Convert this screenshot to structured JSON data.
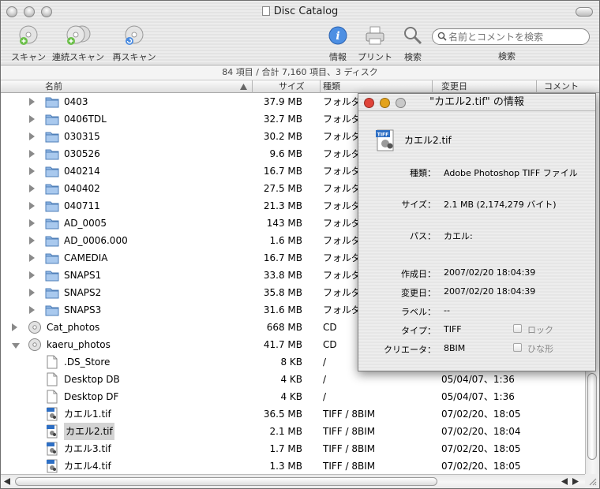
{
  "window": {
    "title": "Disc Catalog"
  },
  "toolbar": {
    "scan": "スキャン",
    "batch_scan": "連続スキャン",
    "rescan": "再スキャン",
    "info": "情報",
    "print": "プリント",
    "search": "検索",
    "search_placeholder": "名前とコメントを検索",
    "search_label": "検索"
  },
  "status": "84 項目 / 合計 7,160 項目、3 ディスク",
  "columns": {
    "name": "名前",
    "size": "サイズ",
    "kind": "種類",
    "modified": "変更日",
    "comment": "コメント"
  },
  "rows": [
    {
      "name": "0403",
      "size": "37.9 MB",
      "kind": "フォルダ",
      "date": ""
    },
    {
      "name": "0406TDL",
      "size": "32.7 MB",
      "kind": "フォルダ",
      "date": ""
    },
    {
      "name": "030315",
      "size": "30.2 MB",
      "kind": "フォルダ",
      "date": ""
    },
    {
      "name": "030526",
      "size": "9.6 MB",
      "kind": "フォルダ",
      "date": ""
    },
    {
      "name": "040214",
      "size": "16.7 MB",
      "kind": "フォルダ",
      "date": ""
    },
    {
      "name": "040402",
      "size": "27.5 MB",
      "kind": "フォルダ",
      "date": ""
    },
    {
      "name": "040711",
      "size": "21.3 MB",
      "kind": "フォルダ",
      "date": ""
    },
    {
      "name": "AD_0005",
      "size": "143 MB",
      "kind": "フォルダ",
      "date": ""
    },
    {
      "name": "AD_0006.000",
      "size": "1.6 MB",
      "kind": "フォルダ",
      "date": ""
    },
    {
      "name": "CAMEDIA",
      "size": "16.7 MB",
      "kind": "フォルダ",
      "date": ""
    },
    {
      "name": "SNAPS1",
      "size": "33.8 MB",
      "kind": "フォルダ",
      "date": ""
    },
    {
      "name": "SNAPS2",
      "size": "35.8 MB",
      "kind": "フォルダ",
      "date": ""
    },
    {
      "name": "SNAPS3",
      "size": "31.6 MB",
      "kind": "フォルダ",
      "date": ""
    },
    {
      "name": "Cat_photos",
      "size": "668 MB",
      "kind": "CD",
      "date": ""
    },
    {
      "name": "kaeru_photos",
      "size": "41.7 MB",
      "kind": "CD",
      "date": ""
    },
    {
      "name": ".DS_Store",
      "size": "8 KB",
      "kind": "/",
      "date": ""
    },
    {
      "name": "Desktop DB",
      "size": "4 KB",
      "kind": "/",
      "date": "05/04/07、1:36"
    },
    {
      "name": "Desktop DF",
      "size": "4 KB",
      "kind": "/",
      "date": "05/04/07、1:36"
    },
    {
      "name": "カエル1.tif",
      "size": "36.5 MB",
      "kind": "TIFF / 8BIM",
      "date": "07/02/20、18:05"
    },
    {
      "name": "カエル2.tif",
      "size": "2.1 MB",
      "kind": "TIFF / 8BIM",
      "date": "07/02/20、18:04"
    },
    {
      "name": "カエル3.tif",
      "size": "1.7 MB",
      "kind": "TIFF / 8BIM",
      "date": "07/02/20、18:05"
    },
    {
      "name": "カエル4.tif",
      "size": "1.3 MB",
      "kind": "TIFF / 8BIM",
      "date": "07/02/20、18:05"
    }
  ],
  "info_window": {
    "title": "\"カエル2.tif\" の情報",
    "icon_badge": "TIFF",
    "filename": "カエル2.tif",
    "labels": {
      "kind": "種類：",
      "size": "サイズ：",
      "path": "パス：",
      "created": "作成日：",
      "modified": "変更日：",
      "label": "ラベル：",
      "type": "タイプ：",
      "creator": "クリエータ："
    },
    "kind": "Adobe Photoshop TIFF ファイル",
    "size": "2.1 MB (2,174,279 バイト)",
    "path": "カエル:",
    "created": "2007/02/20 18:04:39",
    "modified": "2007/02/20 18:04:39",
    "label": "--",
    "type": "TIFF",
    "creator": "8BIM",
    "lock_label": "ロック",
    "stationery_label": "ひな形"
  },
  "colors": {
    "close": "#e0443a",
    "minimize": "#e3a21a",
    "zoom_inactive": "#c9c9c9",
    "folder": "#8fb6e3",
    "accent": "#3a7bd5"
  }
}
